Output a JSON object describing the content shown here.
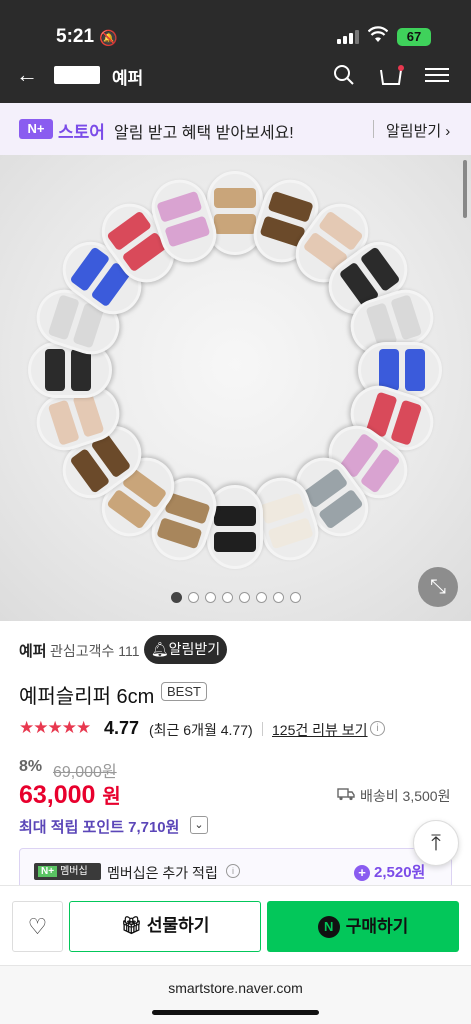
{
  "status_bar": {
    "time": "5:21",
    "battery": "67"
  },
  "header": {
    "store_name": "예퍼",
    "icons": [
      "back-icon",
      "search-icon",
      "cart-icon",
      "menu-icon"
    ]
  },
  "notify_bar": {
    "badge": "N+",
    "store": "스토어",
    "message": "알림 받고 혜택 받아보세요!",
    "action": "알림받기"
  },
  "gallery": {
    "pages": 8,
    "active_page": 1
  },
  "seller": {
    "name": "예퍼",
    "followers_label": "관심고객수 111",
    "alarm_button": "알림받기"
  },
  "product": {
    "name": "예퍼슬리퍼 6cm",
    "badge": "BEST",
    "stars": "★★★★★",
    "rating": "4.77",
    "recent_rating": "(최근 6개월 4.77)",
    "review_link": "125건 리뷰 보기",
    "discount": "8%",
    "original_price": "69,000원",
    "price": "63,000",
    "price_unit": "원",
    "shipping": "배송비 3,500원",
    "points": "최대 적립 포인트 7,710원"
  },
  "membership": {
    "badge_plus": "N+",
    "badge_text": "멤버십",
    "text": "멤버십은 추가 적립",
    "points": "2,520원"
  },
  "actions": {
    "gift": "선물하기",
    "buy": "구매하기",
    "npay": "N"
  },
  "url": "smartstore.naver.com",
  "colors": {
    "accent_green": "#03c75a",
    "price_red": "#e8002d",
    "naver_plus_purple": "#8a5cf0"
  }
}
